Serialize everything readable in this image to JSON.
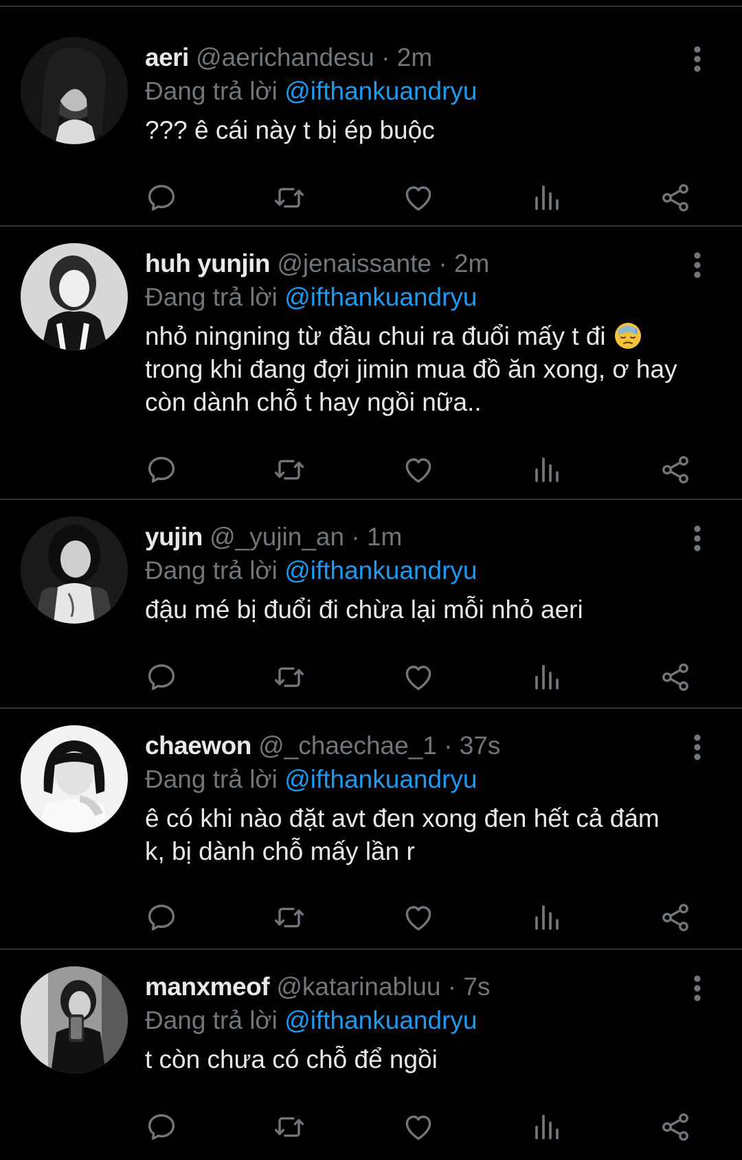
{
  "colors": {
    "background": "#000000",
    "primary_text": "#e7e9ea",
    "secondary_text": "#71767b",
    "mention": "#1d9bf0",
    "divider": "#2f3336"
  },
  "icons": {
    "reply": "speech-bubble-icon",
    "retweet": "retweet-icon",
    "like": "heart-icon",
    "views": "bar-chart-icon",
    "share": "share-icon",
    "more": "vertical-dots-icon"
  },
  "tweets": [
    {
      "name": "aeri",
      "handle": "@aerichandesu",
      "time": "· 2m",
      "replying_prefix": "Đang trả lời",
      "replying_to": "@ifthankuandryu",
      "lines": [
        "??? ê cái này t bị ép buộc"
      ]
    },
    {
      "name": "huh yunjin",
      "handle": "@jenaissante",
      "time": "· 2m",
      "replying_prefix": "Đang trả lời",
      "replying_to": "@ifthankuandryu",
      "lines": [
        "nhỏ ningning từ đầu chui ra đuổi mấy t đi",
        "trong khi đang đợi jimin mua đồ ăn xong, ơ hay",
        "còn dành chỗ t hay ngồi nữa.."
      ],
      "emoji": "downcast-face-with-sweat"
    },
    {
      "name": "yujin",
      "handle": "@_yujin_an",
      "time": "· 1m",
      "replying_prefix": "Đang trả lời",
      "replying_to": "@ifthankuandryu",
      "lines": [
        "đậu mé bị đuổi đi chừa lại mỗi nhỏ aeri"
      ]
    },
    {
      "name": "chaewon",
      "handle": "@_chaechae_1",
      "time": "· 37s",
      "replying_prefix": "Đang trả lời",
      "replying_to": "@ifthankuandryu",
      "lines": [
        "ê có khi nào đặt avt đen xong đen hết cả đám",
        "k, bị dành chỗ mấy lần r"
      ]
    },
    {
      "name": "manxmeof",
      "handle": "@katarinabluu",
      "time": "· 7s",
      "replying_prefix": "Đang trả lời",
      "replying_to": "@ifthankuandryu",
      "lines": [
        "t còn chưa có chỗ để ngồi"
      ]
    }
  ]
}
